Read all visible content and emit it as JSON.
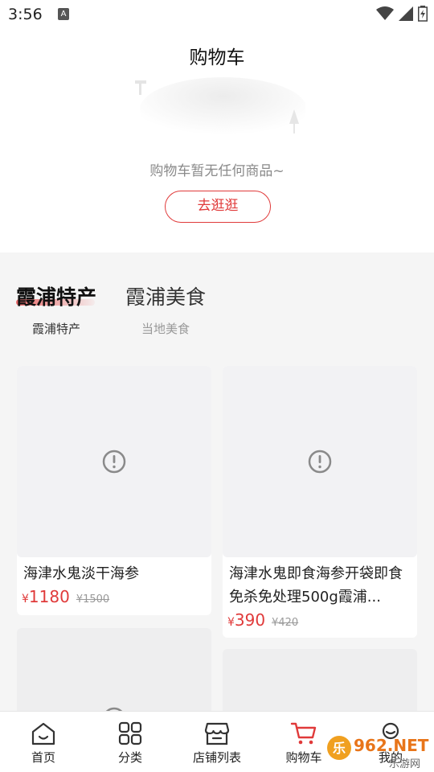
{
  "status_bar": {
    "time": "3:56",
    "notif_letter": "A"
  },
  "header": {
    "title": "购物车",
    "empty_text": "购物车暂无任何商品~",
    "go_button": "去逛逛"
  },
  "tabs": [
    {
      "title": "霞浦特产",
      "subtitle": "霞浦特产",
      "active": true
    },
    {
      "title": "霞浦美食",
      "subtitle": "当地美食",
      "active": false
    }
  ],
  "products": [
    {
      "name": "海津水鬼淡干海参",
      "currency": "¥",
      "price": "1180",
      "old_price": "¥1500"
    },
    {
      "name": "海津水鬼即食海参开袋即食免杀免处理500g霞浦...",
      "currency": "¥",
      "price": "390",
      "old_price": "¥420"
    }
  ],
  "bottom_nav": [
    {
      "label": "首页",
      "icon": "home-icon"
    },
    {
      "label": "分类",
      "icon": "grid-icon"
    },
    {
      "label": "店铺列表",
      "icon": "store-icon"
    },
    {
      "label": "购物车",
      "icon": "cart-icon",
      "active": true
    },
    {
      "label": "我的",
      "icon": "profile-icon"
    }
  ],
  "watermark": {
    "text": "962.NET",
    "sub": "乐游网"
  },
  "colors": {
    "accent": "#e03a3a",
    "background": "#f5f5f5"
  }
}
